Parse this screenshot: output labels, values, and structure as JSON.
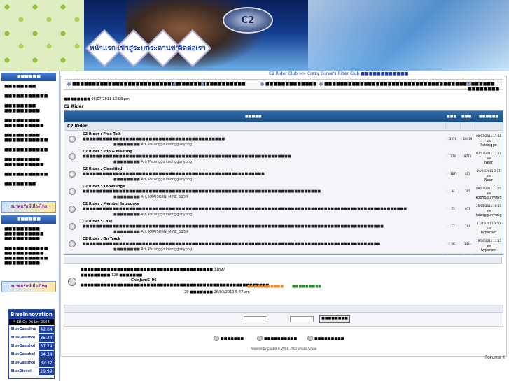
{
  "header": {
    "logo_text": "C2",
    "nav": [
      "หน้าแรก",
      "เข้าสู่ระบบ",
      "กระดานข่าว",
      "ติดต่อเรา"
    ]
  },
  "sidebar": {
    "badge": "สมาคมรักษ์เมืองไทย",
    "fuel": {
      "brand": "BlueInnovation",
      "date": "* CR-Oe 06 Ln. 2554",
      "rows": [
        {
          "name": "BlueGasoline",
          "price": "42.64"
        },
        {
          "name": "BlueGasohol",
          "price": "35.24"
        },
        {
          "name": "BlueGasohol",
          "price": "37.74"
        },
        {
          "name": "BlueGasohol",
          "price": "34.34"
        },
        {
          "name": "BlueGasohol",
          "price": "32.32"
        },
        {
          "name": "BlueDiesel",
          "price": "29.99"
        }
      ]
    }
  },
  "breadcrumb": "C2 Rider Club >> Crazy Curve's Rider Club",
  "main": {
    "last_visit": "08/07/2011 12:08 pm",
    "forum_name": "C2 Rider",
    "category": "C2 Rider",
    "forums": [
      {
        "name": "C2 Rider : Free Talk",
        "mod": "Art, Patonggo koongguny­ong",
        "topics": "1376",
        "posts": "18419",
        "last_date": "08/07/2011 11:41 am",
        "last_user": "Patonggo"
      },
      {
        "name": "C2 Rider : Trip & Meeting",
        "mod": "Art, Patonggo koongguny­ong",
        "topics": "378",
        "posts": "9773",
        "last_date": "02/07/2011 12:07 am",
        "last_user": "Near"
      },
      {
        "name": "C2 Rider : Classified",
        "mod": "Art, Patonggo koongguny­ong",
        "topics": "107",
        "posts": "827",
        "last_date": "24/06/2011 3:17 pm",
        "last_user": "Near"
      },
      {
        "name": "C2 Rider : Knowledge",
        "mod": "Art, KRAISORN_MINE_125R",
        "topics": "44",
        "posts": "305",
        "last_date": "08/07/2011 12:25 am",
        "last_user": "koongguny­ong"
      },
      {
        "name": "C2 Rider : Member Introduce",
        "mod": "Art, Patonggo koongguny­ong",
        "topics": "73",
        "posts": "837",
        "last_date": "25/05/2011 10:15 pm",
        "last_user": "koongguny­ong"
      },
      {
        "name": "C2 Rider : Chat",
        "mod": "Art, KRAISORN_MINE_125R",
        "topics": "17",
        "posts": "204",
        "last_date": "17/04/2011 3:50 pm",
        "last_user": "hyperpro"
      },
      {
        "name": "C2 Rider : On Track",
        "mod": "Art, Patonggo koongguny­ong",
        "topics": "66",
        "posts": "1431",
        "last_date": "19/06/2011 11:15 am",
        "last_user": "hyperpro"
      }
    ],
    "stats": {
      "posts": "31897",
      "users": "128",
      "newest_user": "ChinJumG_06",
      "record": "28",
      "record_date": "26/03/2010 5:47 am"
    },
    "powered_by": "Powered by phpBB © 2001, 2005 phpBB Group"
  },
  "footer": {
    "forums_label": "Forums ©"
  }
}
